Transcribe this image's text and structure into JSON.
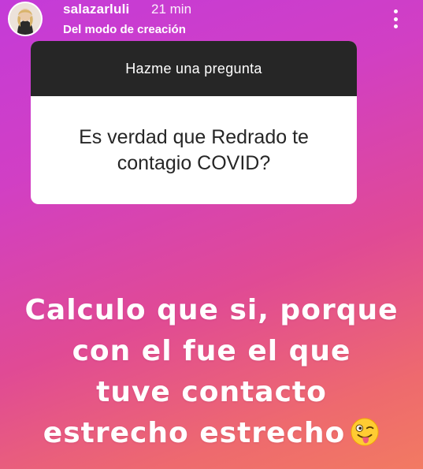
{
  "header": {
    "username": "salazarluli",
    "timestamp": "21 min",
    "subtitle": "Del modo de creación"
  },
  "question_sticker": {
    "prompt": "Hazme una pregunta",
    "question": "Es verdad que Redrado te contagio COVID?"
  },
  "answer_text": {
    "lines": [
      "Calculo que si, porque",
      "con el fue el que",
      "tuve contacto",
      "estrecho estrecho"
    ],
    "emoji": "winking-face-with-tongue"
  },
  "colors": {
    "gradient_start": "#c43bd8",
    "gradient_end": "#f27a62",
    "sticker_header": "#262626",
    "text": "#ffffff"
  }
}
